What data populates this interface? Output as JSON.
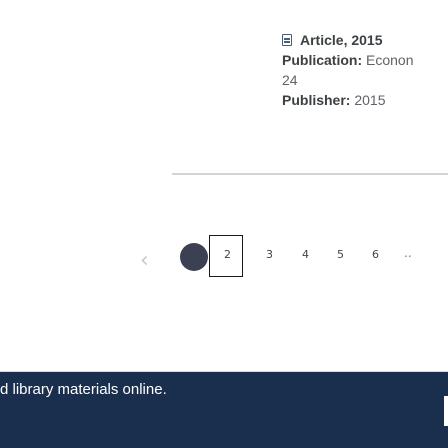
{
  "record": {
    "type_label": "Article, 2015",
    "publication_label": "Publication:",
    "publication_value": "Econon",
    "publication_number": "24",
    "publisher_label": "Publisher:",
    "publisher_value": "2015"
  },
  "pagination": {
    "prev": "‹",
    "pages": [
      "2",
      "3",
      "4",
      "5",
      "6"
    ],
    "ellipsis": "..",
    "next": "("
  },
  "banner": {
    "text": "d library materials online."
  },
  "colors": {
    "banner_bg": "#192f4d",
    "active_page": "#3b4152"
  }
}
